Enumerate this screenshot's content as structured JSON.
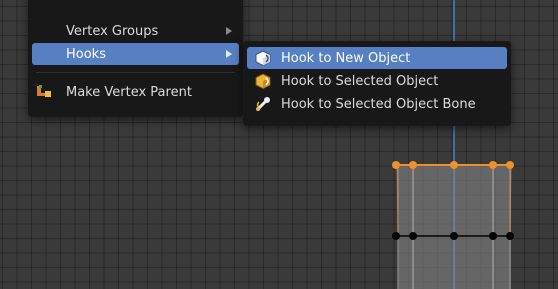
{
  "main_menu": {
    "items": [
      {
        "label": "Vertex Groups",
        "accel": "G",
        "has_submenu": true
      },
      {
        "label": "Hooks",
        "accel": "H",
        "has_submenu": true,
        "active": true
      },
      {
        "label": "Make Vertex Parent",
        "accel": "a",
        "icon": "make-parent-icon"
      }
    ]
  },
  "hooks_menu": {
    "items": [
      {
        "label": "Hook to New Object",
        "icon": "hook-new-object-icon",
        "active": true
      },
      {
        "label": "Hook to Selected Object",
        "icon": "hook-selected-object-icon"
      },
      {
        "label": "Hook to Selected Object Bone",
        "icon": "hook-bone-icon"
      }
    ]
  },
  "colors": {
    "viewport_bg": "#3a3a3a",
    "menu_bg": "#181818",
    "highlight": "#5680c2",
    "selected_vertex": "#f0902a",
    "z_axis": "#3e6fa8"
  }
}
